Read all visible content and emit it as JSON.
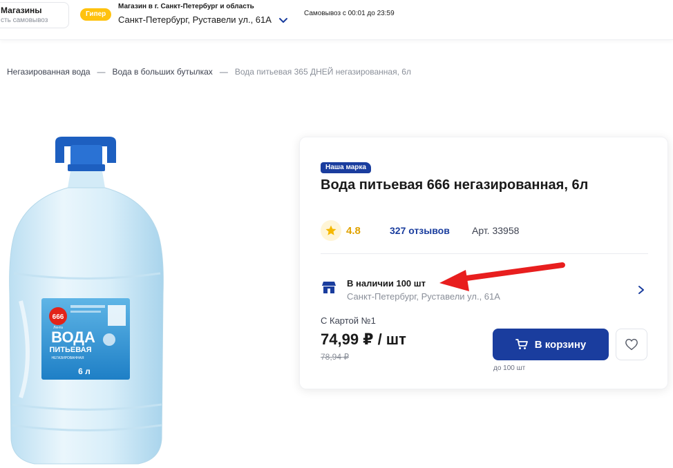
{
  "header": {
    "stores_title": "Магазины",
    "stores_sub": "сть самовывоз",
    "store_type_badge": "Гипер",
    "region_label": "Магазин в г. Санкт-Петербург и область",
    "store_address": "Санкт-Петербург, Руставели ул., 61А",
    "pickup_hours": "Самовывоз с 00:01 до 23:59"
  },
  "breadcrumb": {
    "items": [
      "Негазированная вода",
      "Вода в больших бутылках"
    ],
    "separator": "—",
    "current": "Вода питьевая 365 ДНЕЙ негазированная, 6л"
  },
  "product_image": {
    "logo": "666",
    "logo_sub": "Лента",
    "label_line1": "ВОДА",
    "label_line2": "ПИТЬЕВАЯ",
    "label_line3": "НЕГАЗИРОВАННАЯ",
    "volume": "6 л"
  },
  "product": {
    "brand_badge": "Наша марка",
    "title": "Вода питьевая 666  негазированная, 6л",
    "rating": "4.8",
    "reviews": "327 отзывов",
    "article": "Арт. 33958",
    "availability": "В наличии 100 шт",
    "availability_address": "Санкт-Петербург, Руставели ул., 61А",
    "card_price_label": "С Картой №1",
    "price": "74,99 ₽ / шт",
    "old_price": "78,94 ₽",
    "cart_button": "В корзину",
    "stock_note": "до 100 шт"
  },
  "colors": {
    "brand_blue": "#1a3d9e",
    "accent_yellow": "#ffc20e",
    "annotation_red": "#e81e1e"
  },
  "icons": [
    "chevron-down-icon",
    "star-icon",
    "store-icon",
    "chevron-right-icon",
    "cart-icon",
    "heart-icon"
  ]
}
